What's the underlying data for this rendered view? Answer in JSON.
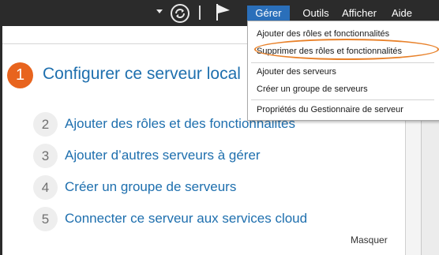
{
  "menubar": {
    "items": [
      {
        "label": "Gérer",
        "active": true
      },
      {
        "label": "Outils",
        "active": false
      },
      {
        "label": "Afficher",
        "active": false
      },
      {
        "label": "Aide",
        "active": false
      }
    ]
  },
  "icons": {
    "caret": "chevron-down-icon",
    "refresh": "refresh-icon",
    "flag": "flag-icon"
  },
  "dropdown": {
    "items": [
      "Ajouter des rôles et fonctionnalités",
      "Supprimer des rôles et fonctionnalités",
      "Ajouter des serveurs",
      "Créer un groupe de serveurs",
      "Propriétés du Gestionnaire de serveur"
    ],
    "highlighted_index": 1
  },
  "main": {
    "primary_step": {
      "number": "1",
      "label": "Configurer ce serveur local"
    },
    "steps": [
      {
        "number": "2",
        "label": "Ajouter des rôles et des fonctionnalités"
      },
      {
        "number": "3",
        "label": "Ajouter d’autres serveurs à gérer"
      },
      {
        "number": "4",
        "label": "Créer un groupe de serveurs"
      },
      {
        "number": "5",
        "label": "Connecter ce serveur aux services cloud"
      }
    ],
    "hide_label": "Masquer"
  },
  "colors": {
    "topbar": "#2b2b2b",
    "menu_active": "#2a6fba",
    "accent_orange": "#e8641e",
    "link_blue": "#1e6fae",
    "highlight": "#e8812a"
  }
}
